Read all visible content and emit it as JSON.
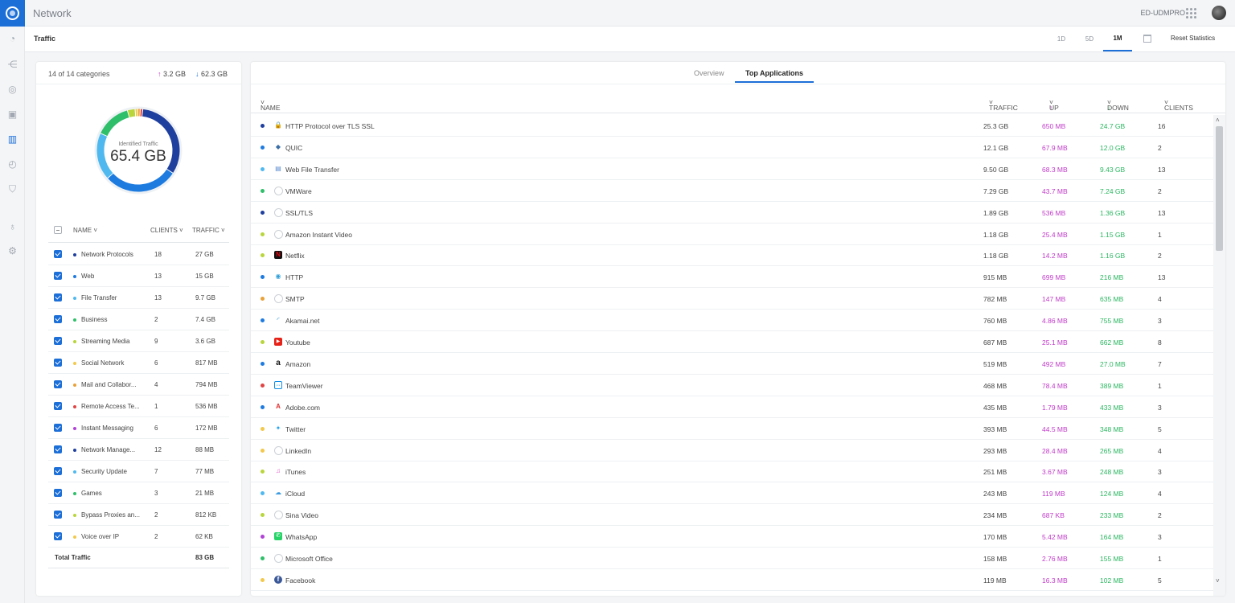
{
  "header": {
    "app_title": "Network",
    "device_name": "ED-UDMPRO"
  },
  "subheader": {
    "page_title": "Traffic",
    "ranges": [
      {
        "label": "1D",
        "active": false
      },
      {
        "label": "5D",
        "active": false
      },
      {
        "label": "1M",
        "active": true
      }
    ],
    "reset_label": "Reset Statistics"
  },
  "summary": {
    "categories_count": "14 of 14 categories",
    "upload_total": "3.2 GB",
    "download_total": "62.3 GB"
  },
  "donut": {
    "label": "Identified Traffic",
    "value": "65.4 GB",
    "segments": [
      {
        "name": "Network Protocols",
        "fraction": 0.325,
        "color": "#1f3f9e"
      },
      {
        "name": "Web",
        "fraction": 0.29,
        "color": "#1d7be0"
      },
      {
        "name": "File Transfer",
        "fraction": 0.185,
        "color": "#4fb9ef"
      },
      {
        "name": "Business",
        "fraction": 0.14,
        "color": "#2fbf6a"
      },
      {
        "name": "Streaming Media",
        "fraction": 0.03,
        "color": "#b9d53c"
      },
      {
        "name": "Social Network",
        "fraction": 0.01,
        "color": "#f2c94c"
      },
      {
        "name": "Mail and Collaboration",
        "fraction": 0.01,
        "color": "#e8a23a"
      },
      {
        "name": "Remote Access",
        "fraction": 0.01,
        "color": "#e04444"
      }
    ]
  },
  "categories": {
    "headers": {
      "name": "NAME",
      "clients": "CLIENTS",
      "traffic": "TRAFFIC"
    },
    "rows": [
      {
        "name": "Network Protocols",
        "clients": "18",
        "traffic": "27 GB",
        "color": "#1f3f9e"
      },
      {
        "name": "Web",
        "clients": "13",
        "traffic": "15 GB",
        "color": "#1d7be0"
      },
      {
        "name": "File Transfer",
        "clients": "13",
        "traffic": "9.7 GB",
        "color": "#4fb9ef"
      },
      {
        "name": "Business",
        "clients": "2",
        "traffic": "7.4 GB",
        "color": "#2fbf6a"
      },
      {
        "name": "Streaming Media",
        "clients": "9",
        "traffic": "3.6 GB",
        "color": "#b9d53c"
      },
      {
        "name": "Social Network",
        "clients": "6",
        "traffic": "817 MB",
        "color": "#f2c94c"
      },
      {
        "name": "Mail and Collabor...",
        "clients": "4",
        "traffic": "794 MB",
        "color": "#e8a23a"
      },
      {
        "name": "Remote Access Te...",
        "clients": "1",
        "traffic": "536 MB",
        "color": "#e04444"
      },
      {
        "name": "Instant Messaging",
        "clients": "6",
        "traffic": "172 MB",
        "color": "#b043d6"
      },
      {
        "name": "Network Manage...",
        "clients": "12",
        "traffic": "88 MB",
        "color": "#1f3f9e"
      },
      {
        "name": "Security Update",
        "clients": "7",
        "traffic": "77 MB",
        "color": "#4fb9ef"
      },
      {
        "name": "Games",
        "clients": "3",
        "traffic": "21 MB",
        "color": "#2fbf6a"
      },
      {
        "name": "Bypass Proxies an...",
        "clients": "2",
        "traffic": "812 KB",
        "color": "#b9d53c"
      },
      {
        "name": "Voice over IP",
        "clients": "2",
        "traffic": "62 KB",
        "color": "#f2c94c"
      }
    ],
    "total_label": "Total Traffic",
    "total_value": "83 GB"
  },
  "tabs": [
    {
      "label": "Overview",
      "active": false
    },
    {
      "label": "Top Applications",
      "active": true
    }
  ],
  "apps": {
    "headers": {
      "name": "NAME",
      "traffic": "TRAFFIC",
      "up": "UP",
      "down": "DOWN",
      "clients": "CLIENTS"
    },
    "rows": [
      {
        "name": "HTTP Protocol over TLS SSL",
        "traffic": "25.3 GB",
        "up": "650 MB",
        "down": "24.7 GB",
        "clients": "16",
        "dot": "#1f3f9e",
        "icon": "lock-icon"
      },
      {
        "name": "QUIC",
        "traffic": "12.1 GB",
        "up": "67.9 MB",
        "down": "12.0 GB",
        "clients": "2",
        "dot": "#1d7be0",
        "icon": "quic-icon"
      },
      {
        "name": "Web File Transfer",
        "traffic": "9.50 GB",
        "up": "68.3 MB",
        "down": "9.43 GB",
        "clients": "13",
        "dot": "#4fb9ef",
        "icon": "file-transfer-icon"
      },
      {
        "name": "VMWare",
        "traffic": "7.29 GB",
        "up": "43.7 MB",
        "down": "7.24 GB",
        "clients": "2",
        "dot": "#2fbf6a",
        "icon": "globe-icon"
      },
      {
        "name": "SSL/TLS",
        "traffic": "1.89 GB",
        "up": "536 MB",
        "down": "1.36 GB",
        "clients": "13",
        "dot": "#1f3f9e",
        "icon": "globe-icon"
      },
      {
        "name": "Amazon Instant Video",
        "traffic": "1.18 GB",
        "up": "25.4 MB",
        "down": "1.15 GB",
        "clients": "1",
        "dot": "#b9d53c",
        "icon": "globe-icon"
      },
      {
        "name": "Netflix",
        "traffic": "1.18 GB",
        "up": "14.2 MB",
        "down": "1.16 GB",
        "clients": "2",
        "dot": "#b9d53c",
        "icon": "netflix-icon"
      },
      {
        "name": "HTTP",
        "traffic": "915 MB",
        "up": "699 MB",
        "down": "216 MB",
        "clients": "13",
        "dot": "#1d7be0",
        "icon": "web-icon"
      },
      {
        "name": "SMTP",
        "traffic": "782 MB",
        "up": "147 MB",
        "down": "635 MB",
        "clients": "4",
        "dot": "#e8a23a",
        "icon": "globe-icon"
      },
      {
        "name": "Akamai.net",
        "traffic": "760 MB",
        "up": "4.86 MB",
        "down": "755 MB",
        "clients": "3",
        "dot": "#1d7be0",
        "icon": "akamai-icon"
      },
      {
        "name": "Youtube",
        "traffic": "687 MB",
        "up": "25.1 MB",
        "down": "662 MB",
        "clients": "8",
        "dot": "#b9d53c",
        "icon": "youtube-icon"
      },
      {
        "name": "Amazon",
        "traffic": "519 MB",
        "up": "492 MB",
        "down": "27.0 MB",
        "clients": "7",
        "dot": "#1d7be0",
        "icon": "amazon-icon"
      },
      {
        "name": "TeamViewer",
        "traffic": "468 MB",
        "up": "78.4 MB",
        "down": "389 MB",
        "clients": "1",
        "dot": "#e04444",
        "icon": "teamviewer-icon"
      },
      {
        "name": "Adobe.com",
        "traffic": "435 MB",
        "up": "1.79 MB",
        "down": "433 MB",
        "clients": "3",
        "dot": "#1d7be0",
        "icon": "adobe-icon"
      },
      {
        "name": "Twitter",
        "traffic": "393 MB",
        "up": "44.5 MB",
        "down": "348 MB",
        "clients": "5",
        "dot": "#f2c94c",
        "icon": "twitter-icon"
      },
      {
        "name": "LinkedIn",
        "traffic": "293 MB",
        "up": "28.4 MB",
        "down": "265 MB",
        "clients": "4",
        "dot": "#f2c94c",
        "icon": "globe-icon"
      },
      {
        "name": "iTunes",
        "traffic": "251 MB",
        "up": "3.67 MB",
        "down": "248 MB",
        "clients": "3",
        "dot": "#b9d53c",
        "icon": "itunes-icon"
      },
      {
        "name": "iCloud",
        "traffic": "243 MB",
        "up": "119 MB",
        "down": "124 MB",
        "clients": "4",
        "dot": "#4fb9ef",
        "icon": "icloud-icon"
      },
      {
        "name": "Sina Video",
        "traffic": "234 MB",
        "up": "687 KB",
        "down": "233 MB",
        "clients": "2",
        "dot": "#b9d53c",
        "icon": "globe-icon"
      },
      {
        "name": "WhatsApp",
        "traffic": "170 MB",
        "up": "5.42 MB",
        "down": "164 MB",
        "clients": "3",
        "dot": "#b043d6",
        "icon": "whatsapp-icon"
      },
      {
        "name": "Microsoft Office",
        "traffic": "158 MB",
        "up": "2.76 MB",
        "down": "155 MB",
        "clients": "1",
        "dot": "#2fbf6a",
        "icon": "globe-icon"
      },
      {
        "name": "Facebook",
        "traffic": "119 MB",
        "up": "16.3 MB",
        "down": "102 MB",
        "clients": "5",
        "dot": "#f2c94c",
        "icon": "facebook-icon"
      }
    ]
  }
}
